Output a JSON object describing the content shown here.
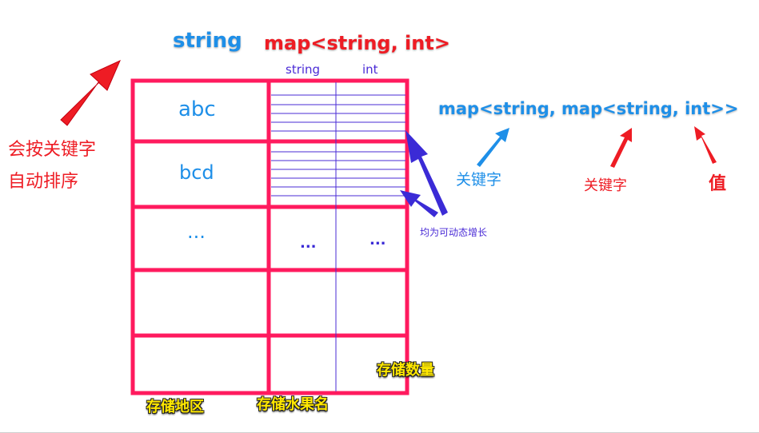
{
  "titles": {
    "key_type": "string",
    "value_type": "map<string, int>"
  },
  "inner_headers": {
    "key": "string",
    "value": "int"
  },
  "regions": [
    "abc",
    "bcd",
    "..."
  ],
  "inner_dots": [
    "...",
    "..."
  ],
  "side_note": {
    "line1": "会按关键字",
    "line2": "自动排序"
  },
  "signature": "map<string, map<string, int>>",
  "signature_labels": {
    "outer_key": "关键字",
    "inner_key": "关键字",
    "value": "值"
  },
  "growth_note": "均为可动态增长",
  "bottom_labels": {
    "region": "存储地区",
    "fruit": "存储水果名",
    "quantity": "存储数量"
  },
  "colors": {
    "grid": "#ff1a5e",
    "blue": "#1e8fe8",
    "red": "#ee1c24",
    "purple": "#4a2bd6",
    "yellow": "#ffe800"
  }
}
